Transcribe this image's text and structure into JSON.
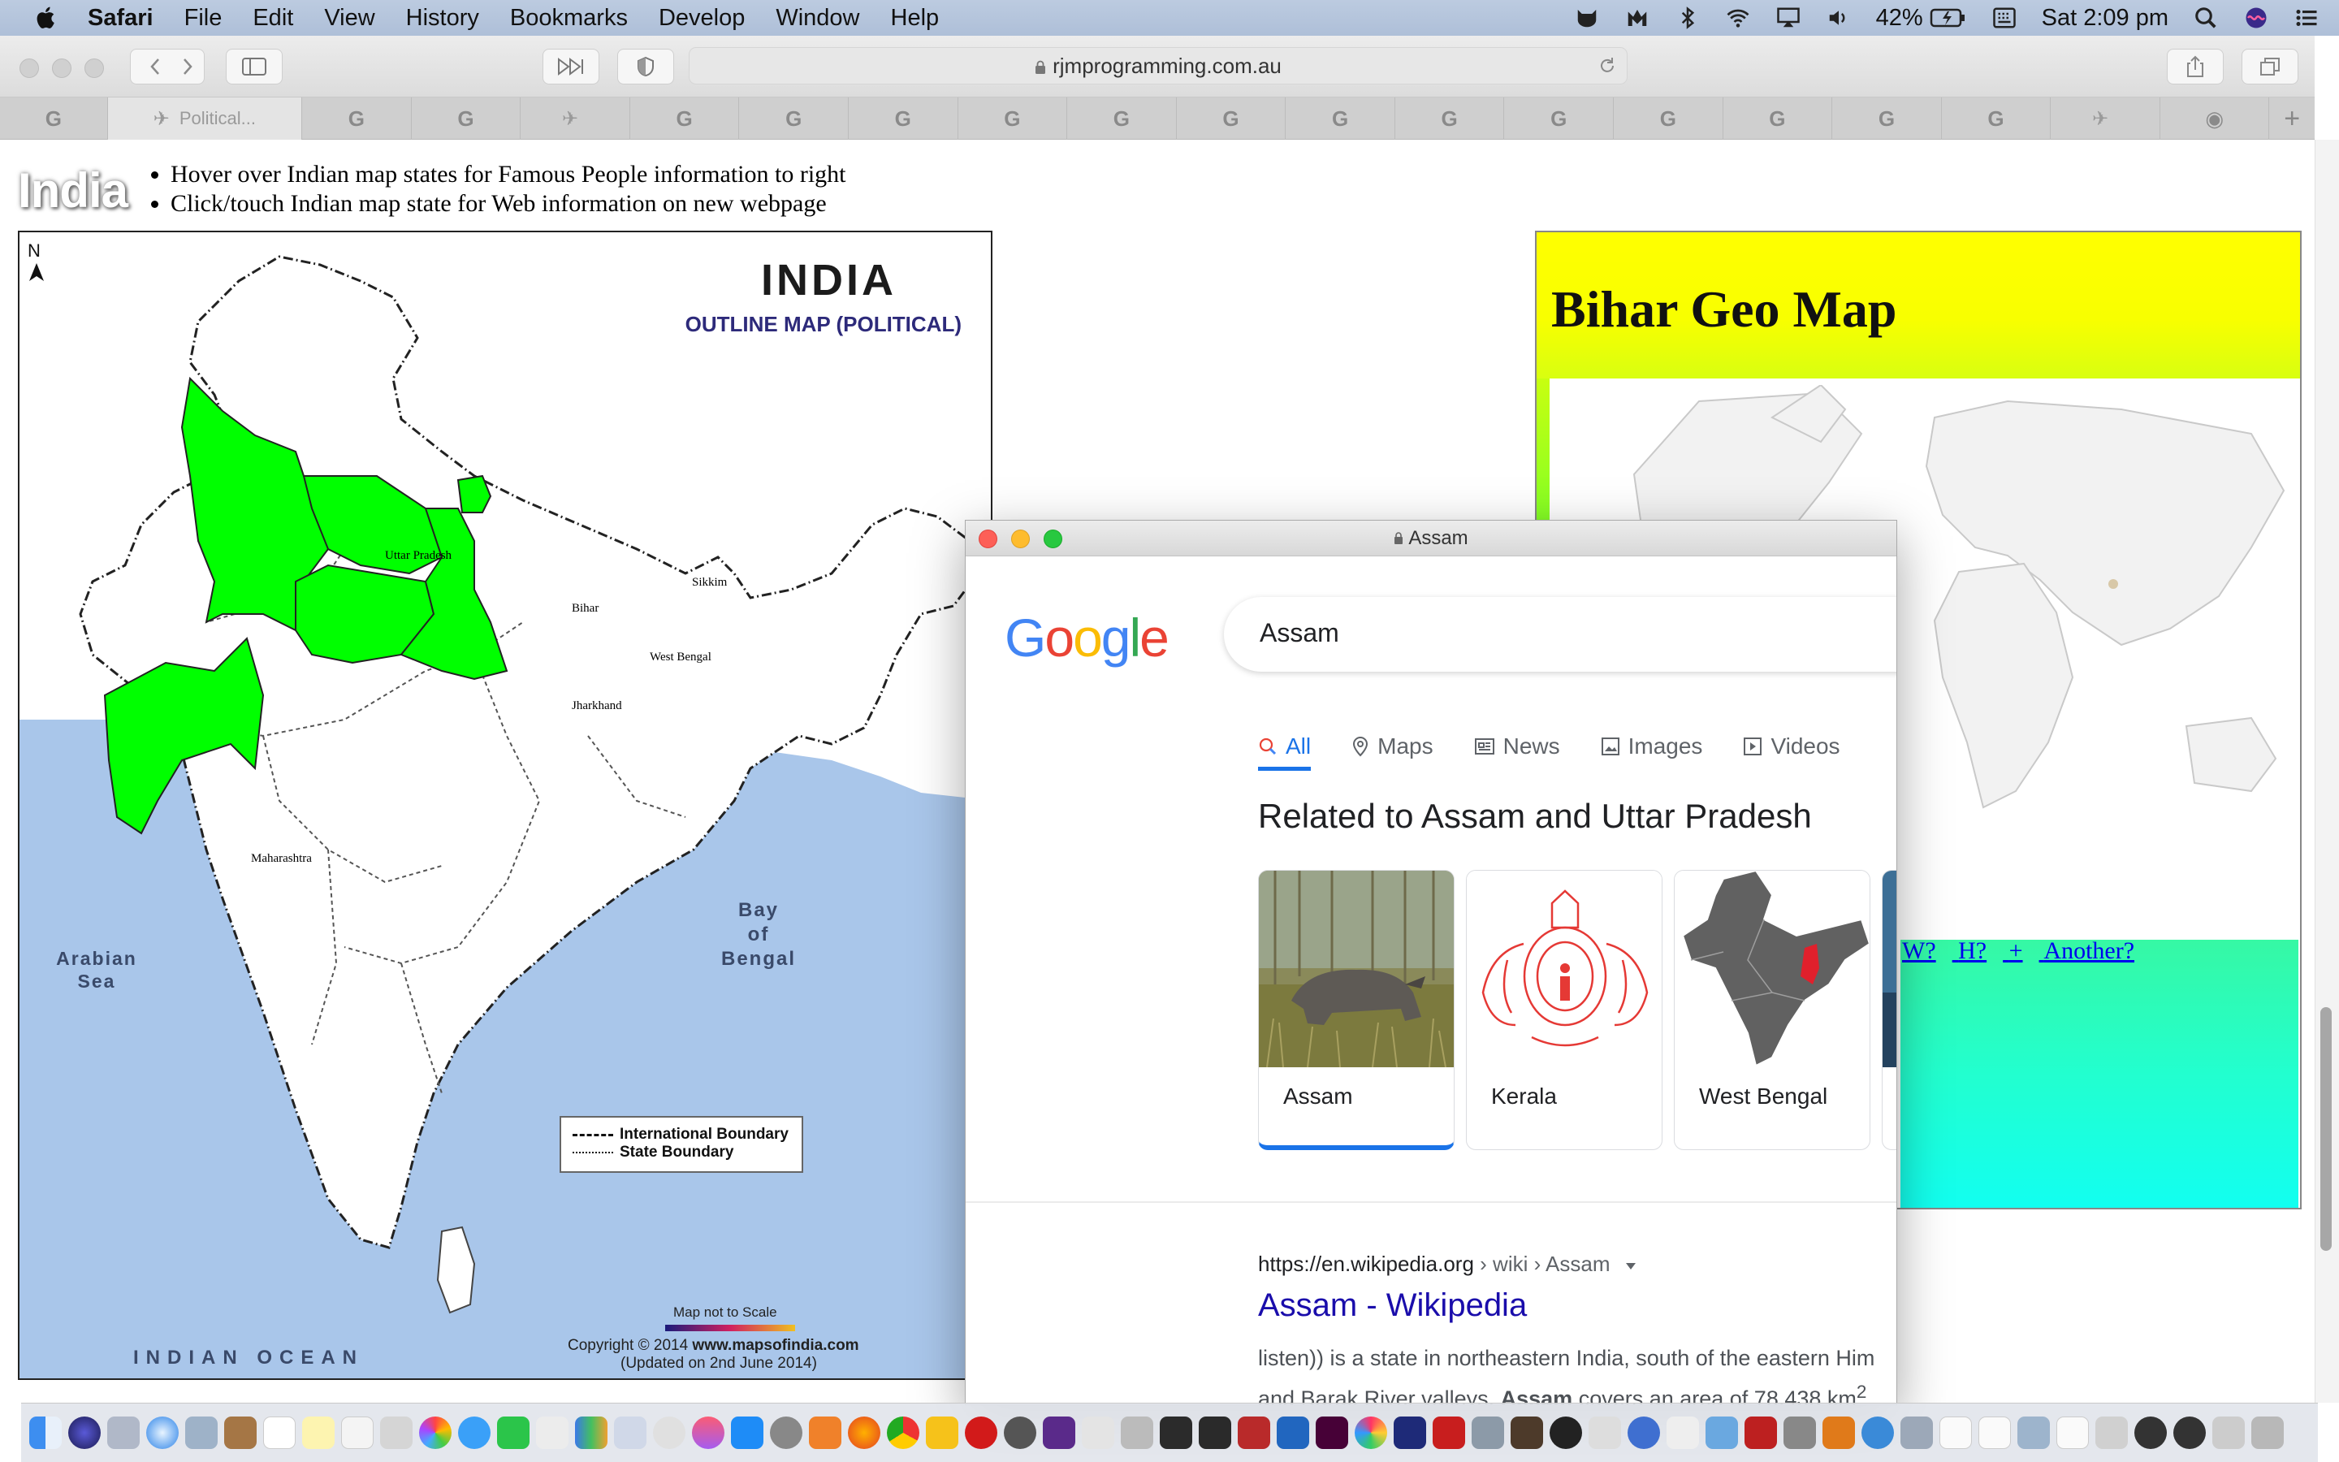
{
  "menubar": {
    "app_name": "Safari",
    "menus": [
      "File",
      "Edit",
      "View",
      "History",
      "Bookmarks",
      "Develop",
      "Window",
      "Help"
    ],
    "battery": "42%",
    "clock": "Sat 2:09 pm"
  },
  "toolbar": {
    "url": "rjmprogramming.com.au"
  },
  "tabs": {
    "active_title": "Political...",
    "count": 21
  },
  "page": {
    "heading": "India",
    "bullets": [
      "Hover over Indian map states for Famous People information to right",
      "Click/touch Indian map state for Web information on new webpage"
    ],
    "map": {
      "compass": "N",
      "title": "INDIA",
      "subtitle": "OUTLINE MAP (POLITICAL)",
      "states": [
        "Uttar Pradesh",
        "Bihar",
        "Sikkim",
        "West Bengal",
        "Jharkhand",
        "Maharashtra"
      ],
      "seas": {
        "bay_line1": "Bay",
        "bay_line2": "of",
        "bay_line3": "Bengal",
        "arabian_line1": "Arabian",
        "arabian_line2": "Sea",
        "ocean": "INDIAN OCEAN"
      },
      "legend": [
        "International Boundary",
        "State Boundary"
      ],
      "scale_note": "Map not to Scale",
      "copyright_prefix": "Copyright © 2014",
      "copyright_site": "www.mapsofindia.com",
      "updated": "(Updated on 2nd June 2014)"
    },
    "side_panel": {
      "title": "Bihar Geo Map",
      "links": [
        "W?",
        "H?",
        "+",
        "Another?"
      ]
    }
  },
  "popup": {
    "window_title": "Assam",
    "logo": "Google",
    "query": "Assam",
    "tabs": [
      "All",
      "Maps",
      "News",
      "Images",
      "Videos"
    ],
    "related_heading": "Related to Assam and Uttar Pradesh",
    "cards": [
      "Assam",
      "Kerala",
      "West Bengal"
    ],
    "result": {
      "cite_domain": "https://en.wikipedia.org",
      "cite_path": " › wiki › Assam",
      "title": "Assam - Wikipedia",
      "snippet_line1": "listen)) is a state in northeastern India, south of the eastern Him",
      "snippet_line2_a": "and Barak River valleys. ",
      "snippet_line2_b": "Assam",
      "snippet_line2_c": " covers an area of 78,438 km",
      "snippet_sup": "2"
    }
  },
  "colors": {
    "highlight_state": "#00ff00",
    "sea": "#a9c6ea",
    "google_blue": "#1a73e8",
    "link": "#0000ee",
    "result_title": "#1a0dab"
  }
}
